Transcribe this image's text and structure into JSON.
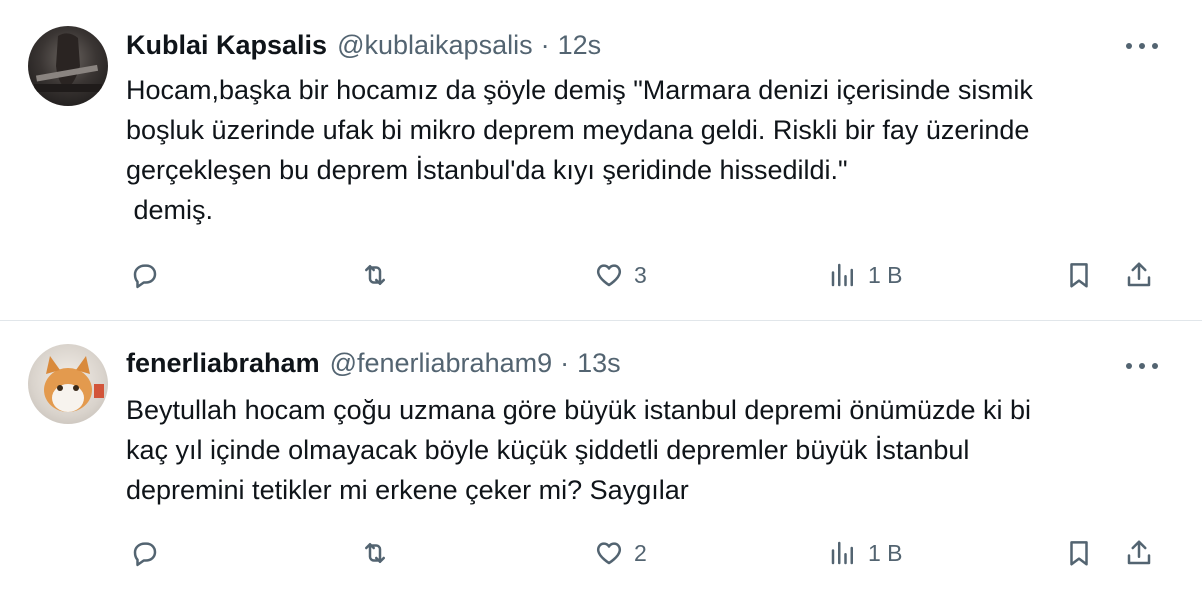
{
  "tweets": [
    {
      "name": "Kublai Kapsalis",
      "handle": "@kublaikapsalis",
      "separator": "·",
      "time": "12s",
      "lines": [
        "Hocam,başka bir hocamız da şöyle demiş \"Marmara denizi içerisinde sismik",
        "boşluk üzerinde ufak bi mikro deprem meydana geldi. Riskli bir fay üzerinde",
        "gerçekleşen bu deprem İstanbul'da kıyı şeridinde hissedildi.\"",
        " demiş."
      ],
      "likes": "3",
      "views": "1 B"
    },
    {
      "name": "fenerliabraham",
      "handle": "@fenerliabraham9",
      "separator": "·",
      "time": "13s",
      "lines": [
        "Beytullah hocam çoğu uzmana göre büyük istanbul depremi önümüzde ki bi",
        "kaç yıl içinde olmayacak böyle küçük şiddetli depremler büyük İstanbul",
        "depremini tetikler mi erkene çeker mi? Saygılar"
      ],
      "likes": "2",
      "views": "1 B"
    }
  ],
  "icons": {
    "reply": "reply-icon",
    "retweet": "retweet-icon",
    "like": "heart-icon",
    "views": "views-icon",
    "bookmark": "bookmark-icon",
    "share": "share-icon",
    "more": "more-icon"
  },
  "colors": {
    "text": "#0f1419",
    "secondary": "#536471",
    "divider": "#e1e6ea"
  }
}
